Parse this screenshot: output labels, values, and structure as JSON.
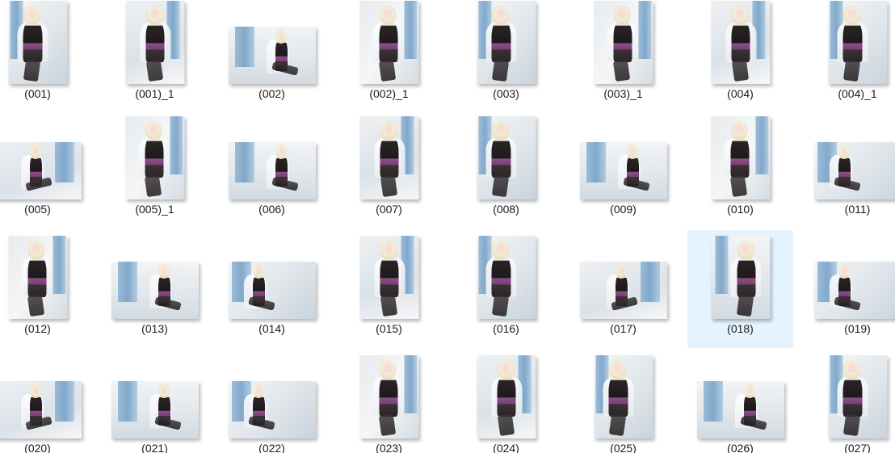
{
  "window": {
    "view": "large-icons",
    "selection_color": "#e5f3ff"
  },
  "items": [
    {
      "label": "(001)",
      "orientation": "portrait",
      "variant": 0
    },
    {
      "label": "(001)_1",
      "orientation": "portrait",
      "variant": 1
    },
    {
      "label": "(002)",
      "orientation": "landscape",
      "variant": 2
    },
    {
      "label": "(002)_1",
      "orientation": "portrait",
      "variant": 3
    },
    {
      "label": "(003)",
      "orientation": "portrait",
      "variant": 0
    },
    {
      "label": "(003)_1",
      "orientation": "portrait",
      "variant": 3
    },
    {
      "label": "(004)",
      "orientation": "portrait",
      "variant": 1
    },
    {
      "label": "(004)_1",
      "orientation": "portrait",
      "variant": 0
    },
    {
      "label": "(005)",
      "orientation": "landscape",
      "variant": 1
    },
    {
      "label": "(005)_1",
      "orientation": "portrait",
      "variant": 3
    },
    {
      "label": "(006)",
      "orientation": "landscape",
      "variant": 2
    },
    {
      "label": "(007)",
      "orientation": "portrait",
      "variant": 1
    },
    {
      "label": "(008)",
      "orientation": "portrait",
      "variant": 0
    },
    {
      "label": "(009)",
      "orientation": "landscape",
      "variant": 2
    },
    {
      "label": "(010)",
      "orientation": "portrait",
      "variant": 3
    },
    {
      "label": "(011)",
      "orientation": "landscape",
      "variant": 0
    },
    {
      "label": "(012)",
      "orientation": "portrait",
      "variant": 3
    },
    {
      "label": "(013)",
      "orientation": "landscape",
      "variant": 2
    },
    {
      "label": "(014)",
      "orientation": "landscape",
      "variant": 0
    },
    {
      "label": "(015)",
      "orientation": "portrait",
      "variant": 1
    },
    {
      "label": "(016)",
      "orientation": "portrait",
      "variant": 0
    },
    {
      "label": "(017)",
      "orientation": "landscape",
      "variant": 1
    },
    {
      "label": "(018)",
      "orientation": "portrait",
      "variant": 2,
      "selected": true
    },
    {
      "label": "(019)",
      "orientation": "landscape",
      "variant": 0
    },
    {
      "label": "(020)",
      "orientation": "landscape",
      "variant": 1
    },
    {
      "label": "(021)",
      "orientation": "landscape",
      "variant": 2
    },
    {
      "label": "(022)",
      "orientation": "landscape",
      "variant": 0
    },
    {
      "label": "(023)",
      "orientation": "portrait",
      "variant": 3
    },
    {
      "label": "(024)",
      "orientation": "portrait",
      "variant": 1
    },
    {
      "label": "(025)",
      "orientation": "portrait",
      "variant": 0
    },
    {
      "label": "(026)",
      "orientation": "landscape",
      "variant": 2
    },
    {
      "label": "(027)",
      "orientation": "portrait",
      "variant": 0
    }
  ]
}
